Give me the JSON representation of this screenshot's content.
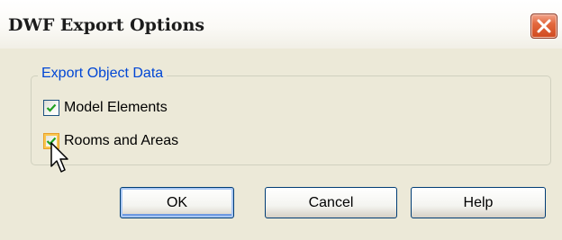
{
  "window": {
    "title": "DWF Export Options",
    "close_icon": "close-x-icon"
  },
  "group": {
    "legend": "Export Object Data",
    "options": [
      {
        "label": "Model Elements",
        "checked": true
      },
      {
        "label": "Rooms and Areas",
        "checked": true
      }
    ]
  },
  "buttons": {
    "ok": "OK",
    "cancel": "Cancel",
    "help": "Help"
  },
  "colors": {
    "dialog_face": "#ece9d8",
    "legend_text": "#0046d5",
    "check_mark": "#21a121",
    "close_button": "#e3683d",
    "button_border": "#003c74"
  }
}
